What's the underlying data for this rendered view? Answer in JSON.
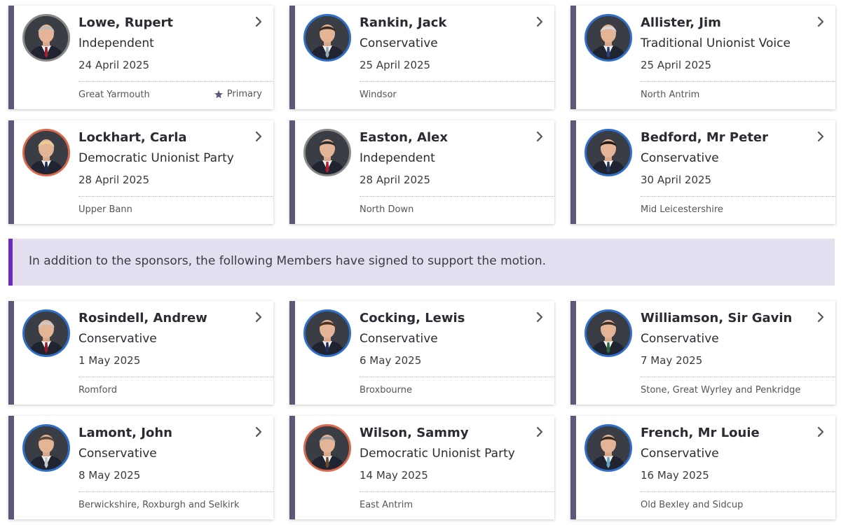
{
  "sponsors": [
    {
      "name": "Lowe, Rupert",
      "party": "Independent",
      "date": "24 April 2025",
      "constituency": "Great Yarmouth",
      "badge": "Primary",
      "ring": "#8a8a8a",
      "hair": "#b9b9b9",
      "tie": "#9b2230"
    },
    {
      "name": "Rankin, Jack",
      "party": "Conservative",
      "date": "25 April 2025",
      "constituency": "Windsor",
      "ring": "#2f6fc9",
      "hair": "#3b2a20",
      "tie": "#9aa8b8"
    },
    {
      "name": "Allister, Jim",
      "party": "Traditional Unionist Voice",
      "date": "25 April 2025",
      "constituency": "North Antrim",
      "ring": "#2f6fc9",
      "hair": "#d8d8d8",
      "tie": "#2b3f7a"
    },
    {
      "name": "Lockhart, Carla",
      "party": "Democratic Unionist Party",
      "date": "28 April 2025",
      "constituency": "Upper Bann",
      "ring": "#d9694a",
      "hair": "#e7cf95",
      "tie": "#1e2a4a"
    },
    {
      "name": "Easton, Alex",
      "party": "Independent",
      "date": "28 April 2025",
      "constituency": "North Down",
      "ring": "#8a8a8a",
      "hair": "#2a2a2a",
      "tie": "#b51e2a"
    },
    {
      "name": "Bedford, Mr Peter",
      "party": "Conservative",
      "date": "30 April 2025",
      "constituency": "Mid Leicestershire",
      "ring": "#2f6fc9",
      "hair": "#1f1712",
      "tie": "#25385f"
    }
  ],
  "banner": {
    "text": "In addition to the sponsors, the following Members have signed to support the motion."
  },
  "supporters": [
    {
      "name": "Rosindell, Andrew",
      "party": "Conservative",
      "date": "1 May 2025",
      "constituency": "Romford",
      "ring": "#2f6fc9",
      "hair": "#c9c9c9",
      "tie": "#8f1d2c"
    },
    {
      "name": "Cocking, Lewis",
      "party": "Conservative",
      "date": "6 May 2025",
      "constituency": "Broxbourne",
      "ring": "#2f6fc9",
      "hair": "#4a3220",
      "tie": "#1d2f5a"
    },
    {
      "name": "Williamson, Sir Gavin",
      "party": "Conservative",
      "date": "7 May 2025",
      "constituency": "Stone, Great Wyrley and Penkridge",
      "ring": "#2f6fc9",
      "hair": "#3a2f28",
      "tie": "#2d6a3e"
    },
    {
      "name": "Lamont, John",
      "party": "Conservative",
      "date": "8 May 2025",
      "constituency": "Berwickshire, Roxburgh and Selkirk",
      "ring": "#2f6fc9",
      "hair": "#5a4a3e",
      "tie": "#c8c8c8"
    },
    {
      "name": "Wilson, Sammy",
      "party": "Democratic Unionist Party",
      "date": "14 May 2025",
      "constituency": "East Antrim",
      "ring": "#d9694a",
      "hair": "#9a9a9a",
      "tie": "#6b4a2a"
    },
    {
      "name": "French, Mr Louie",
      "party": "Conservative",
      "date": "16 May 2025",
      "constituency": "Old Bexley and Sidcup",
      "ring": "#2f6fc9",
      "hair": "#3a2a1f",
      "tie": "#5fa8c8"
    }
  ],
  "icons": {
    "chevron": "chevron-right-icon",
    "star": "star-icon",
    "avatar": "member-photo"
  },
  "colors": {
    "card_accent": "#5d5878",
    "banner_bg": "#e4dff0",
    "banner_accent": "#6b2bbf",
    "conservative_ring": "#2f6fc9",
    "dup_ring": "#d9694a",
    "independent_ring": "#8a8a8a"
  }
}
